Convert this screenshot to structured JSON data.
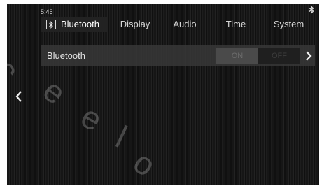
{
  "status_bar": {
    "time": "5:45",
    "bluetooth_icon": "bluetooth-icon"
  },
  "tabs": [
    {
      "label": "Bluetooth",
      "icon": "bluetooth-icon",
      "selected": true
    },
    {
      "label": "Display",
      "selected": false
    },
    {
      "label": "Audio",
      "selected": false
    },
    {
      "label": "Time",
      "selected": false
    },
    {
      "label": "System",
      "selected": false
    }
  ],
  "bluetooth_setting": {
    "label": "Bluetooth",
    "on_label": "ON",
    "off_label": "OFF",
    "next_icon": "chevron-right-icon"
  },
  "navigation": {
    "back_icon": "chevron-left-icon"
  },
  "colors": {
    "screen_background": "#161616",
    "row_background": "#373737",
    "text": "#d6d6d6"
  }
}
